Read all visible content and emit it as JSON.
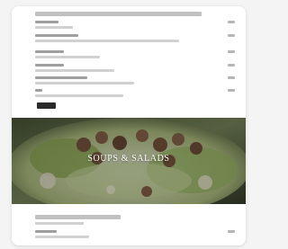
{
  "banner": {
    "title": "SOUPS & SALADS"
  },
  "colors": {
    "page_background": "#f4f4f4",
    "card_background": "#ffffff",
    "button": "#2b2b2b",
    "banner_text": "#ffffff"
  },
  "icons": {
    "order_button": "blurred-dark-button"
  },
  "menu_top": {
    "row_count": 6
  },
  "menu_bottom": {
    "row_count": 2
  }
}
